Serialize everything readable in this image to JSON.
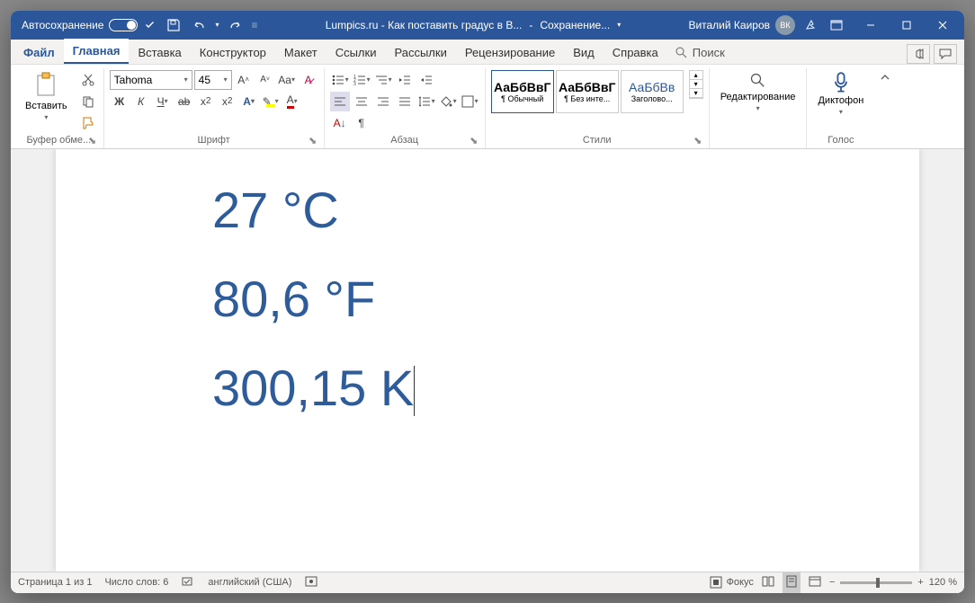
{
  "titlebar": {
    "autosave": "Автосохранение",
    "doc_title": "Lumpics.ru - Как поставить градус в В...",
    "saving": "Сохранение...",
    "user": "Виталий Каиров",
    "initials": "ВК"
  },
  "tabs": {
    "file": "Файл",
    "home": "Главная",
    "insert": "Вставка",
    "design": "Конструктор",
    "layout": "Макет",
    "references": "Ссылки",
    "mailings": "Рассылки",
    "review": "Рецензирование",
    "view": "Вид",
    "help": "Справка",
    "search": "Поиск"
  },
  "ribbon": {
    "clipboard": {
      "paste": "Вставить",
      "label": "Буфер обме..."
    },
    "font": {
      "name": "Tahoma",
      "size": "45",
      "label": "Шрифт"
    },
    "paragraph": {
      "label": "Абзац"
    },
    "styles": {
      "label": "Стили",
      "items": [
        {
          "preview": "АаБбВвГ",
          "name": "¶ Обычный"
        },
        {
          "preview": "АаБбВвГ",
          "name": "¶ Без инте..."
        },
        {
          "preview": "АаБбВв",
          "name": "Заголово..."
        }
      ]
    },
    "editing": {
      "label": "Редактирование"
    },
    "voice": {
      "btn": "Диктофон",
      "label": "Голос"
    }
  },
  "document": {
    "line1": "27 °C",
    "line2": "80,6 °F",
    "line3": "300,15 K"
  },
  "status": {
    "page": "Страница 1 из 1",
    "words": "Число слов: 6",
    "lang": "английский (США)",
    "focus": "Фокус",
    "zoom": "120 %"
  }
}
